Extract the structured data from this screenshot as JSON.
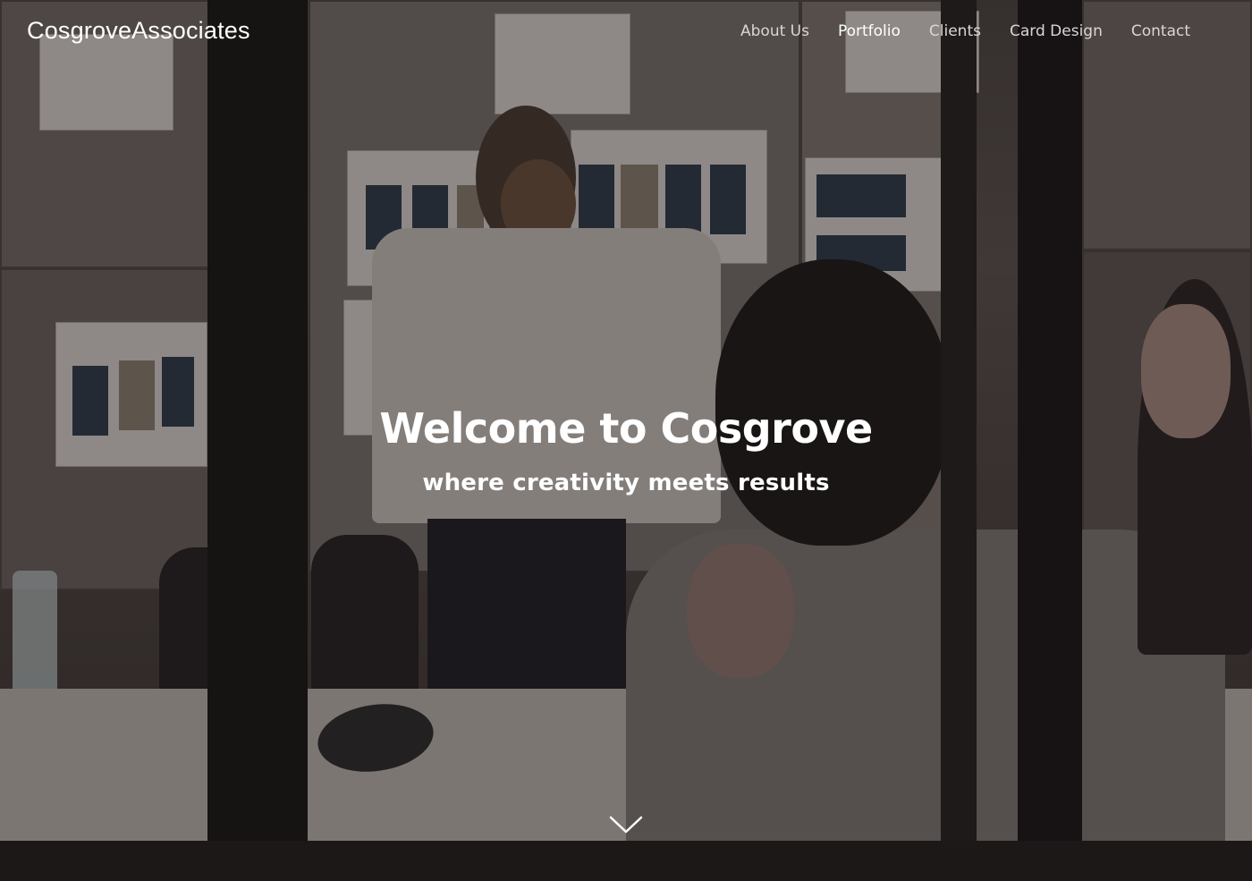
{
  "brand": {
    "name": "CosgroveAssociates"
  },
  "nav": {
    "items": [
      {
        "label": "About Us"
      },
      {
        "label": "Portfolio"
      },
      {
        "label": "Clients"
      },
      {
        "label": "Card Design"
      },
      {
        "label": "Contact"
      }
    ],
    "active": "Portfolio"
  },
  "hero": {
    "title": "Welcome to Cosgrove",
    "subtitle": "where creativity meets results",
    "scroll_icon": "chevron-down-icon",
    "background": "photo-meeting-room"
  },
  "colors": {
    "text": "#ffffff",
    "nav_text": "#d9d6d4",
    "overlay": "#14100f"
  }
}
